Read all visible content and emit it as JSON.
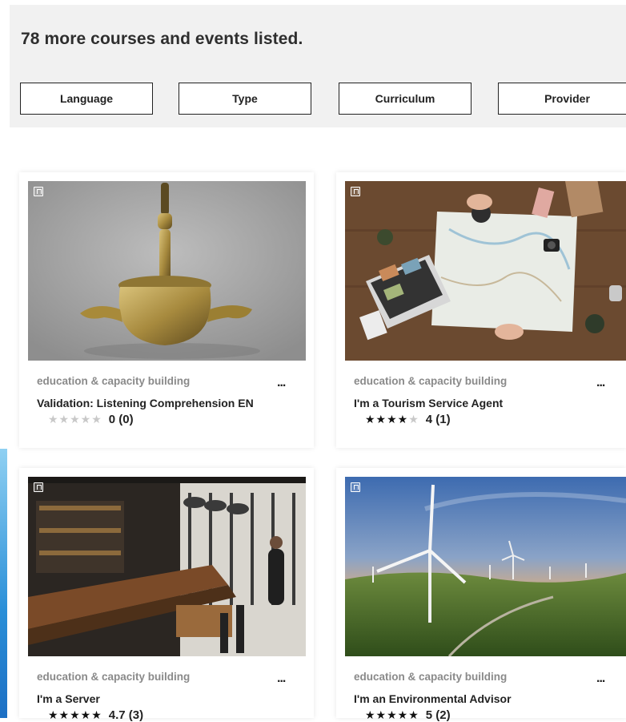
{
  "header": {
    "results_text": "78 more courses and events listed.",
    "filters": [
      "Language",
      "Type",
      "Curriculum",
      "Provider"
    ]
  },
  "cards": [
    {
      "image": "brass-vessel-photo",
      "category": "education & capacity building",
      "more": "...",
      "title": "Validation: Listening Comprehension EN",
      "rating": 0,
      "rating_text": "0 (0)"
    },
    {
      "image": "map-travel-desk-photo",
      "category": "education & capacity building",
      "more": "...",
      "title": "I'm a Tourism Service Agent",
      "rating": 4,
      "rating_text": "4 (1)"
    },
    {
      "image": "restaurant-bar-photo",
      "category": "education & capacity building",
      "more": "...",
      "title": "I'm a Server",
      "rating": 4.7,
      "rating_text": "4.7 (3)"
    },
    {
      "image": "wind-turbines-photo",
      "category": "education & capacity building",
      "more": "...",
      "title": "I'm an Environmental Advisor",
      "rating": 5,
      "rating_text": "5 (2)"
    }
  ]
}
